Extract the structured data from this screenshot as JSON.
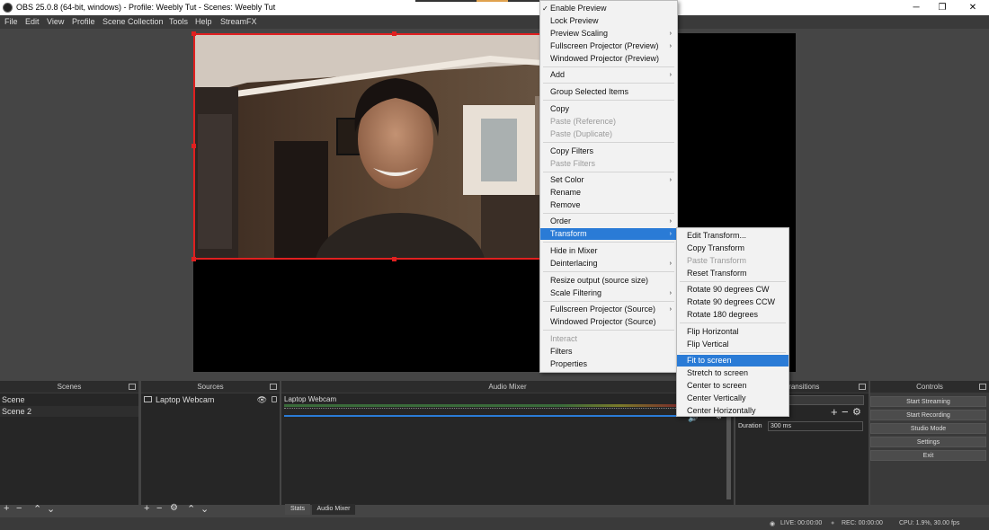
{
  "window": {
    "title": "OBS 25.0.8 (64-bit, windows) - Profile: Weebly Tut - Scenes: Weebly Tut",
    "minimize": "─",
    "maximize": "❐",
    "close": "✕"
  },
  "menubar": [
    "File",
    "Edit",
    "View",
    "Profile",
    "Scene Collection",
    "Tools",
    "Help",
    "StreamFX"
  ],
  "context_menu": {
    "items": [
      {
        "label": "Enable Preview",
        "checked": "✓"
      },
      {
        "label": "Lock Preview"
      },
      {
        "label": "Preview Scaling",
        "sub": "›"
      },
      {
        "label": "Fullscreen Projector (Preview)",
        "sub": "›"
      },
      {
        "label": "Windowed Projector (Preview)"
      },
      {
        "label": "Add",
        "sub": "›"
      },
      {
        "label": "Group Selected Items"
      },
      {
        "label": "Copy"
      },
      {
        "label": "Paste (Reference)"
      },
      {
        "label": "Paste (Duplicate)"
      },
      {
        "label": "Copy Filters"
      },
      {
        "label": "Paste Filters"
      },
      {
        "label": "Set Color",
        "sub": "›"
      },
      {
        "label": "Rename"
      },
      {
        "label": "Remove"
      },
      {
        "label": "Order",
        "sub": "›"
      },
      {
        "label": "Transform",
        "sub": "›"
      },
      {
        "label": "Hide in Mixer"
      },
      {
        "label": "Deinterlacing",
        "sub": "›"
      },
      {
        "label": "Resize output (source size)"
      },
      {
        "label": "Scale Filtering",
        "sub": "›"
      },
      {
        "label": "Fullscreen Projector (Source)",
        "sub": "›"
      },
      {
        "label": "Windowed Projector (Source)"
      },
      {
        "label": "Interact"
      },
      {
        "label": "Filters"
      },
      {
        "label": "Properties"
      }
    ]
  },
  "transform_menu": {
    "items": [
      {
        "label": "Edit Transform..."
      },
      {
        "label": "Copy Transform"
      },
      {
        "label": "Paste Transform"
      },
      {
        "label": "Reset Transform"
      },
      {
        "label": "Rotate 90 degrees CW"
      },
      {
        "label": "Rotate 90 degrees CCW"
      },
      {
        "label": "Rotate 180 degrees"
      },
      {
        "label": "Flip Horizontal"
      },
      {
        "label": "Flip Vertical"
      },
      {
        "label": "Fit to screen"
      },
      {
        "label": "Stretch to screen"
      },
      {
        "label": "Center to screen"
      },
      {
        "label": "Center Vertically"
      },
      {
        "label": "Center Horizontally"
      }
    ]
  },
  "docks": {
    "scenes": {
      "title": "Scenes",
      "items": [
        "Scene",
        "Scene 2"
      ]
    },
    "sources": {
      "title": "Sources",
      "items": [
        "Laptop Webcam"
      ]
    },
    "mixer": {
      "title": "Audio Mixer",
      "track": "Laptop Webcam",
      "tabs": [
        "Stats",
        "Audio Mixer"
      ]
    },
    "transitions": {
      "title": "Transitions",
      "duration_label": "Duration",
      "duration_value": "300 ms"
    },
    "controls": {
      "title": "Controls",
      "buttons": [
        "Start Streaming",
        "Start Recording",
        "Studio Mode",
        "Settings",
        "Exit"
      ]
    }
  },
  "status": {
    "live": "LIVE: 00:00:00",
    "rec": "REC: 00:00:00",
    "cpu": "CPU: 1.9%, 30.00 fps"
  },
  "colors": {
    "selection": "#e02020",
    "menu_highlight": "#2a7bd6",
    "volume_bar": "#2a7bd6"
  }
}
